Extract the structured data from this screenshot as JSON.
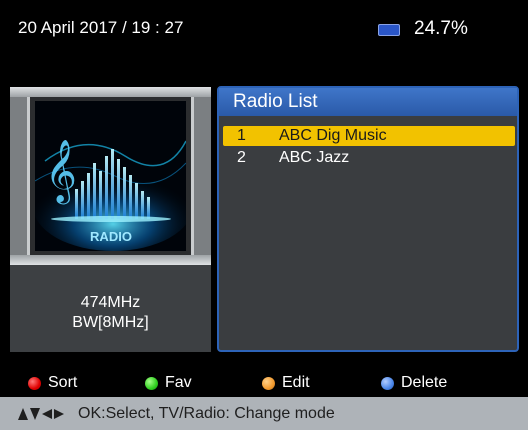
{
  "header": {
    "datetime": "20 April 2017 / 19 : 27",
    "battery_percent": "24.7%"
  },
  "artwork": {
    "logo_text": "RADIO"
  },
  "channel_info": {
    "frequency": "474MHz",
    "bandwidth": "BW[8MHz]"
  },
  "radio_list": {
    "title": "Radio List",
    "items": [
      {
        "number": "1",
        "name": "ABC Dig Music",
        "selected": true
      },
      {
        "number": "2",
        "name": "ABC Jazz",
        "selected": false
      }
    ]
  },
  "legend": {
    "sort": "Sort",
    "fav": "Fav",
    "edit": "Edit",
    "delete": "Delete"
  },
  "footer": {
    "hint": "OK:Select, TV/Radio: Change mode"
  },
  "colors": {
    "selection": "#f2c200",
    "panel_header": "#2a5aa8",
    "footer_bg": "#aeb3b8"
  }
}
